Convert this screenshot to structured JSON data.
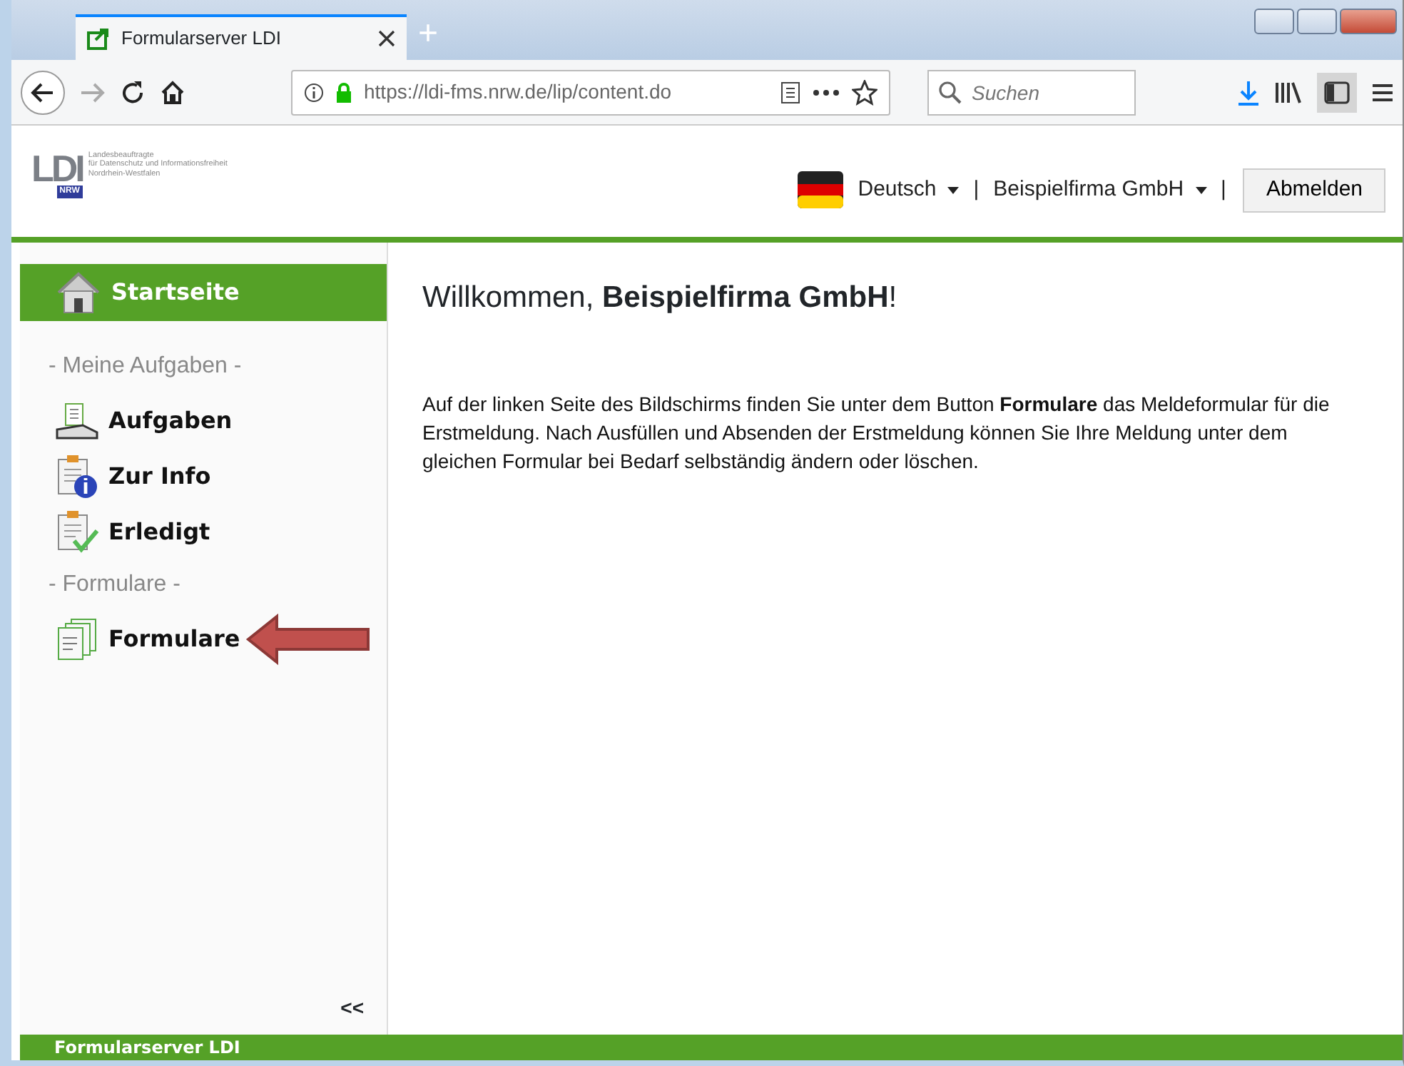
{
  "browser": {
    "tab_title": "Formularserver LDI",
    "new_tab": "+",
    "url": "https://ldi-fms.nrw.de/lip/content.do",
    "search_placeholder": "Suchen"
  },
  "header": {
    "logo": {
      "mark": "LDI",
      "sub": "NRW",
      "lines": [
        "Landesbeauftragte",
        "für Datenschutz und Informationsfreiheit",
        "Nordrhein-Westfalen"
      ]
    },
    "language": "Deutsch",
    "separator_1": "|",
    "company": "Beispielfirma GmbH",
    "separator_2": "|",
    "logout": "Abmelden"
  },
  "sidebar": {
    "items": [
      {
        "kind": "home",
        "label": "Startseite",
        "selected": true
      },
      {
        "kind": "section",
        "label": "- Meine Aufgaben -"
      },
      {
        "kind": "tasks",
        "label": "Aufgaben",
        "selected": false
      },
      {
        "kind": "info",
        "label": "Zur Info",
        "selected": false
      },
      {
        "kind": "done",
        "label": "Erledigt",
        "selected": false
      },
      {
        "kind": "section",
        "label": "- Formulare -"
      },
      {
        "kind": "forms",
        "label": "Formulare",
        "selected": false,
        "pointer": true
      }
    ],
    "collapse": "<<"
  },
  "content": {
    "heading": "Willkommen, **Beispielfirma GmbH**!",
    "text": "Auf der linken Seite des Bildschirms finden Sie unter dem Button **Formulare** das Meldeformular für die Erstmeldung. Nach Ausfüllen und Absenden der Erstmeldung können Sie Ihre Meldung unter dem gleichen Formular bei Bedarf selbständig ändern oder löschen."
  },
  "footer": "Formularserver LDI"
}
